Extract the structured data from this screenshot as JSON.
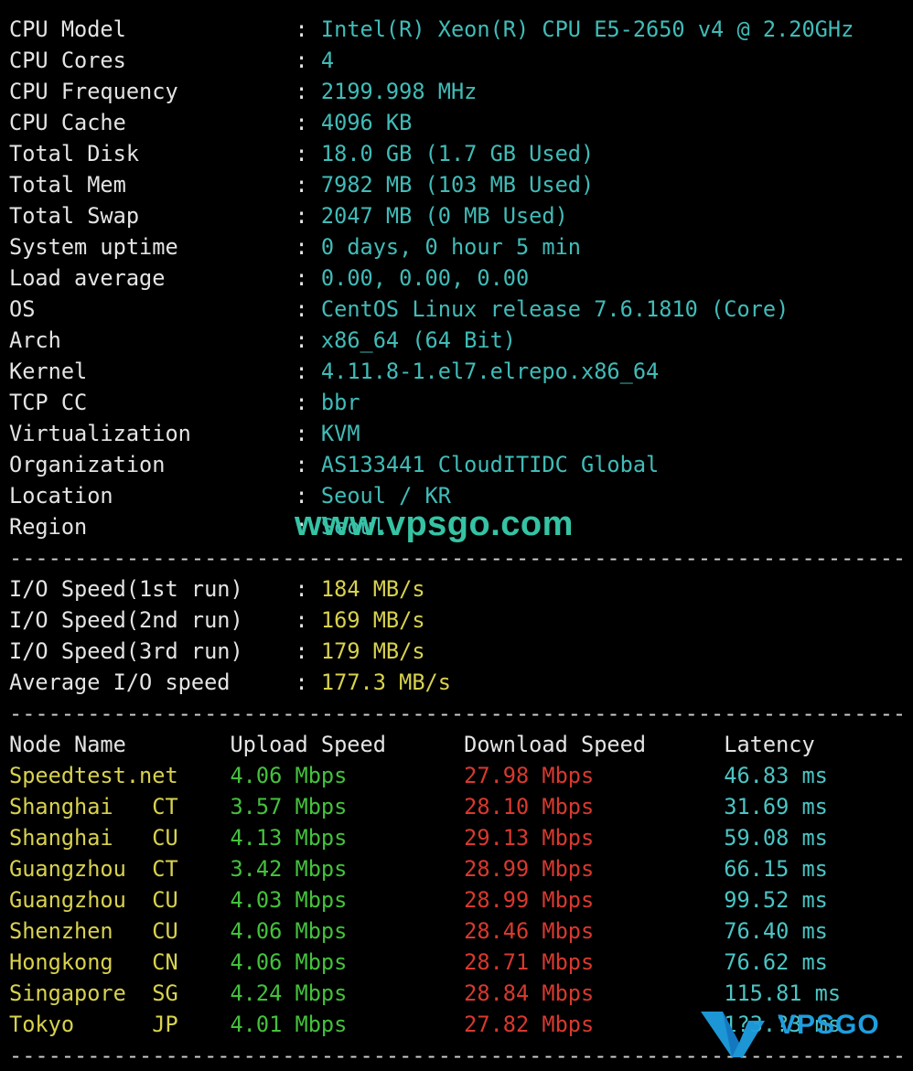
{
  "info": [
    {
      "label": "CPU Model",
      "value": "Intel(R) Xeon(R) CPU E5-2650 v4 @ 2.20GHz"
    },
    {
      "label": "CPU Cores",
      "value": "4"
    },
    {
      "label": "CPU Frequency",
      "value": "2199.998 MHz"
    },
    {
      "label": "CPU Cache",
      "value": "4096 KB"
    },
    {
      "label": "Total Disk",
      "value": "18.0 GB (1.7 GB Used)"
    },
    {
      "label": "Total Mem",
      "value": "7982 MB (103 MB Used)"
    },
    {
      "label": "Total Swap",
      "value": "2047 MB (0 MB Used)"
    },
    {
      "label": "System uptime",
      "value": "0 days, 0 hour 5 min"
    },
    {
      "label": "Load average",
      "value": "0.00, 0.00, 0.00"
    },
    {
      "label": "OS",
      "value": "CentOS Linux release 7.6.1810 (Core)"
    },
    {
      "label": "Arch",
      "value": "x86_64 (64 Bit)"
    },
    {
      "label": "Kernel",
      "value": "4.11.8-1.el7.elrepo.x86_64"
    },
    {
      "label": "TCP CC",
      "value": "bbr"
    },
    {
      "label": "Virtualization",
      "value": "KVM"
    },
    {
      "label": "Organization",
      "value": "AS133441 CloudITIDC Global"
    },
    {
      "label": "Location",
      "value": "Seoul / KR"
    },
    {
      "label": "Region",
      "value": "Seoul"
    }
  ],
  "colon": ":",
  "separator": "---------------------------------------------------------------------",
  "io": [
    {
      "label": "I/O Speed(1st run)",
      "value": "184 MB/s"
    },
    {
      "label": "I/O Speed(2nd run)",
      "value": "169 MB/s"
    },
    {
      "label": "I/O Speed(3rd run)",
      "value": "179 MB/s"
    },
    {
      "label": "Average I/O speed",
      "value": "177.3 MB/s"
    }
  ],
  "speed_table": {
    "headers": [
      "Node Name",
      "Upload Speed",
      "Download Speed",
      "Latency"
    ],
    "rows": [
      {
        "node": "Speedtest.net",
        "isp": "",
        "up": "4.06 Mbps",
        "down": "27.98 Mbps",
        "lat": "46.83 ms"
      },
      {
        "node": "Shanghai",
        "isp": "CT",
        "up": "3.57 Mbps",
        "down": "28.10 Mbps",
        "lat": "31.69 ms"
      },
      {
        "node": "Shanghai",
        "isp": "CU",
        "up": "4.13 Mbps",
        "down": "29.13 Mbps",
        "lat": "59.08 ms"
      },
      {
        "node": "Guangzhou",
        "isp": "CT",
        "up": "3.42 Mbps",
        "down": "28.99 Mbps",
        "lat": "66.15 ms"
      },
      {
        "node": "Guangzhou",
        "isp": "CU",
        "up": "4.03 Mbps",
        "down": "28.99 Mbps",
        "lat": "99.52 ms"
      },
      {
        "node": "Shenzhen",
        "isp": "CU",
        "up": "4.06 Mbps",
        "down": "28.46 Mbps",
        "lat": "76.40 ms"
      },
      {
        "node": "Hongkong",
        "isp": "CN",
        "up": "4.06 Mbps",
        "down": "28.71 Mbps",
        "lat": "76.62 ms"
      },
      {
        "node": "Singapore",
        "isp": "SG",
        "up": "4.24 Mbps",
        "down": "28.84 Mbps",
        "lat": "115.81 ms"
      },
      {
        "node": "Tokyo",
        "isp": "JP",
        "up": "4.01 Mbps",
        "down": "27.82 Mbps",
        "lat": "1?3.?3 ms"
      }
    ]
  },
  "watermarks": {
    "site": "www.vpsgo.com",
    "logo": "VPSGO"
  },
  "colors": {
    "label": "#e4e4e4",
    "value": "#41bcb8",
    "io": "#d8d24e",
    "upload": "#44c23c",
    "download": "#d8392f",
    "latency": "#4cc4c4",
    "watermark": "#35c3a4",
    "logo": "#1e9ee0"
  }
}
